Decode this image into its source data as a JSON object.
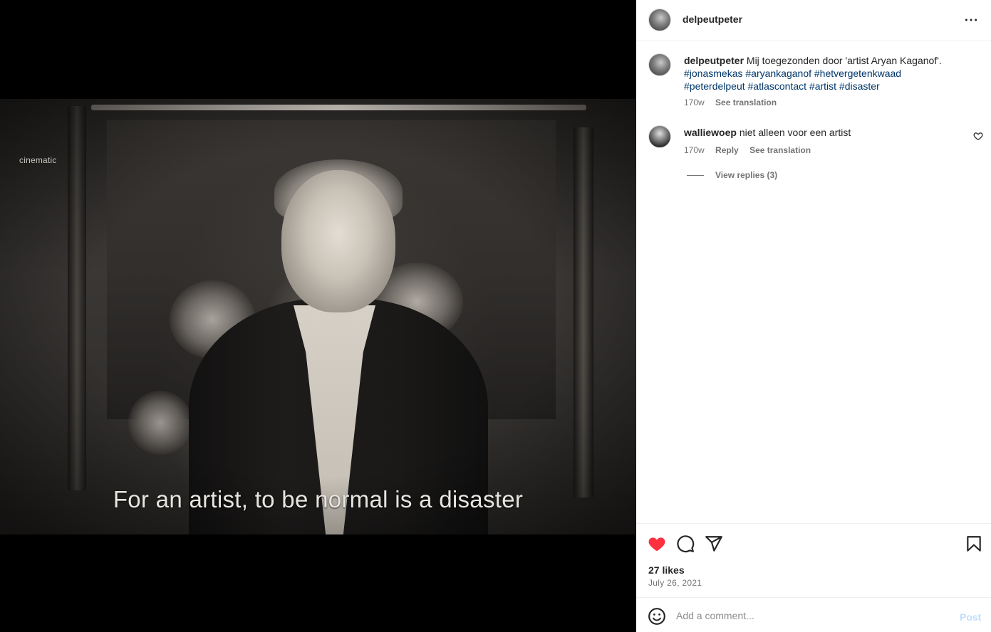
{
  "media": {
    "watermark": "cinematic",
    "subtitle": "For an artist, to be normal is a disaster"
  },
  "header": {
    "username": "delpeutpeter"
  },
  "caption": {
    "username": "delpeutpeter",
    "text": "Mij toegezonden door 'artist Aryan Kaganof'.",
    "hashtags_line1": "#jonasmekas #aryankaganof #hetvergetenkwaad",
    "hashtags_line2": "#peterdelpeut #atlascontact #artist #disaster",
    "age": "170w",
    "see_translation": "See translation"
  },
  "comment": {
    "username": "walliewoep",
    "text": "niet alleen voor een artist",
    "age": "170w",
    "reply": "Reply",
    "see_translation": "See translation",
    "view_replies": "View replies (3)"
  },
  "post_actions": {
    "likes": "27 likes",
    "date": "July 26, 2021",
    "like_color": "#ff3040"
  },
  "composer": {
    "placeholder": "Add a comment...",
    "post_label": "Post"
  }
}
